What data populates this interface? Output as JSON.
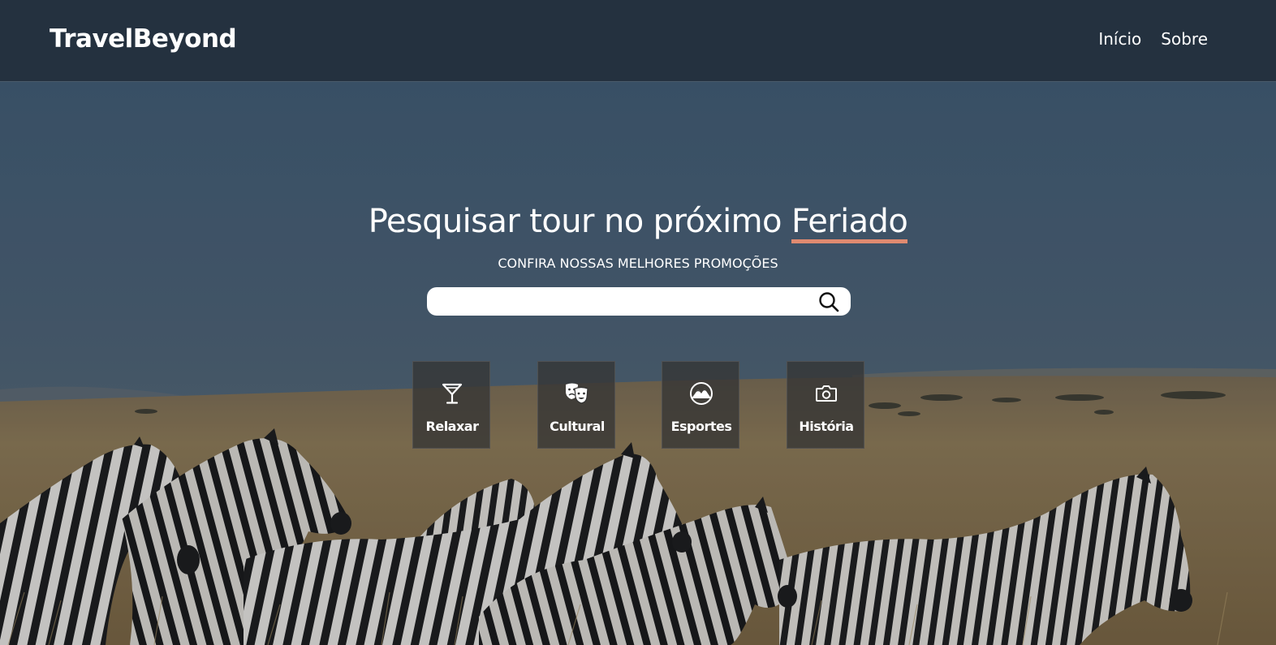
{
  "navbar": {
    "brand": "TravelBeyond",
    "links": [
      {
        "label": "Início"
      },
      {
        "label": "Sobre"
      }
    ]
  },
  "hero": {
    "title_prefix": "Pesquisar tour no próximo",
    "title_accent": "Feriado",
    "subtitle": "CONFIRA NOSSAS MELHORES PROMOÇÕES",
    "search": {
      "value": "",
      "placeholder": ""
    },
    "accent_color": "#e08a70"
  },
  "categories": [
    {
      "label": "Relaxar",
      "icon": "cocktail-glass-icon"
    },
    {
      "label": "Cultural",
      "icon": "theater-masks-icon"
    },
    {
      "label": "Esportes",
      "icon": "mountain-icon"
    },
    {
      "label": "História",
      "icon": "camera-icon"
    }
  ]
}
